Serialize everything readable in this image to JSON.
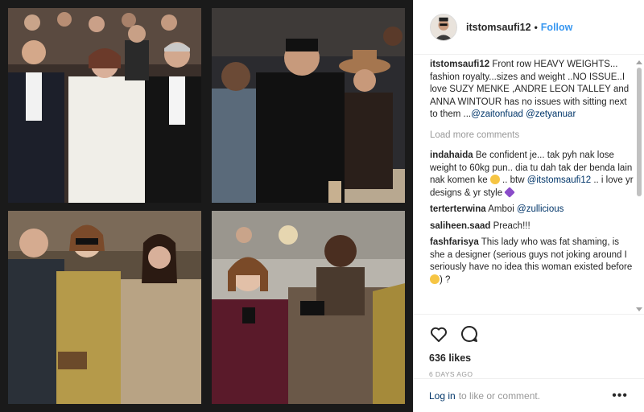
{
  "post": {
    "username": "itstomsaufi12",
    "separator": "•",
    "follow_label": "Follow",
    "caption_user": "itstomsaufi12",
    "caption_parts": [
      "Front row HEAVY WEIGHTS... fashion royalty...sizes and weight ..NO ISSUE..I love SUZY MENKE ,ANDRE LEON TALLEY and ANNA WINTOUR has no issues with sitting next to them ...",
      "@zaitonfuad",
      "@zetyanuar"
    ],
    "load_more_label": "Load more comments",
    "likes": "636 likes",
    "time_ago": "6 DAYS AGO",
    "login_link": "Log in",
    "login_rest": "to like or comment.",
    "more_label": "•••"
  },
  "comments": [
    {
      "user": "indahaida",
      "text_a": "Be confident je... tak pyh nak lose weight to 60kg pun.. dia tu dah tak der benda lain nak komen ke",
      "text_b": ".. btw",
      "mention": "@itstomsaufi12",
      "text_c": ".. i love yr designs & yr style"
    },
    {
      "user": "terterterwina",
      "text": "Amboi",
      "mention": "@zullicious"
    },
    {
      "user": "saliheen.saad",
      "text": "Preach!!!"
    },
    {
      "user": "fashfarisya",
      "text_a": "This lady who was fat shaming, is she a designer (serious guys not joking around I seriously have no idea this woman existed before",
      "text_b": ") ?"
    }
  ],
  "icons": {
    "like": "heart-outline-icon",
    "comment": "comment-bubble-icon"
  },
  "colors": {
    "accent_blue": "#3897f0",
    "link_dark": "#003569",
    "muted": "#999999",
    "photo_bg": "#1a1a1a"
  }
}
